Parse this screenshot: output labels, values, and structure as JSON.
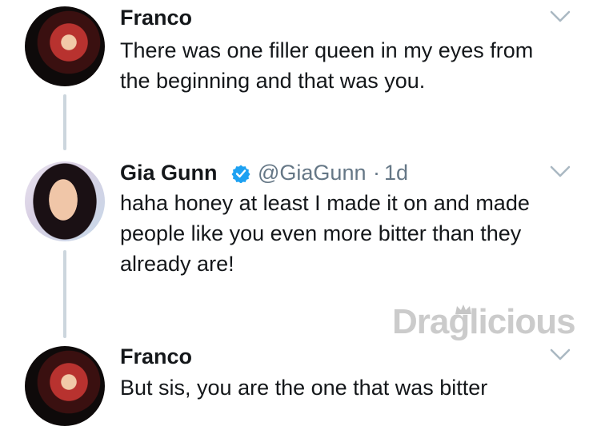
{
  "tweets": [
    {
      "name": "Franco",
      "text": "There was one filler queen in my eyes from the beginning and that was you."
    },
    {
      "name": "Gia Gunn",
      "handle": "@GiaGunn",
      "separator": "·",
      "time": "1d",
      "verified": true,
      "text": "haha honey at least I made it on and made people like you even more bitter than they already are!"
    },
    {
      "name": "Franco",
      "text": "But sis, you are the one that was bitter"
    }
  ],
  "watermark": "Draglicious",
  "colors": {
    "text": "#14171a",
    "secondary": "#657786",
    "verified": "#1da1f2",
    "thread_line": "#ccd6dd"
  }
}
